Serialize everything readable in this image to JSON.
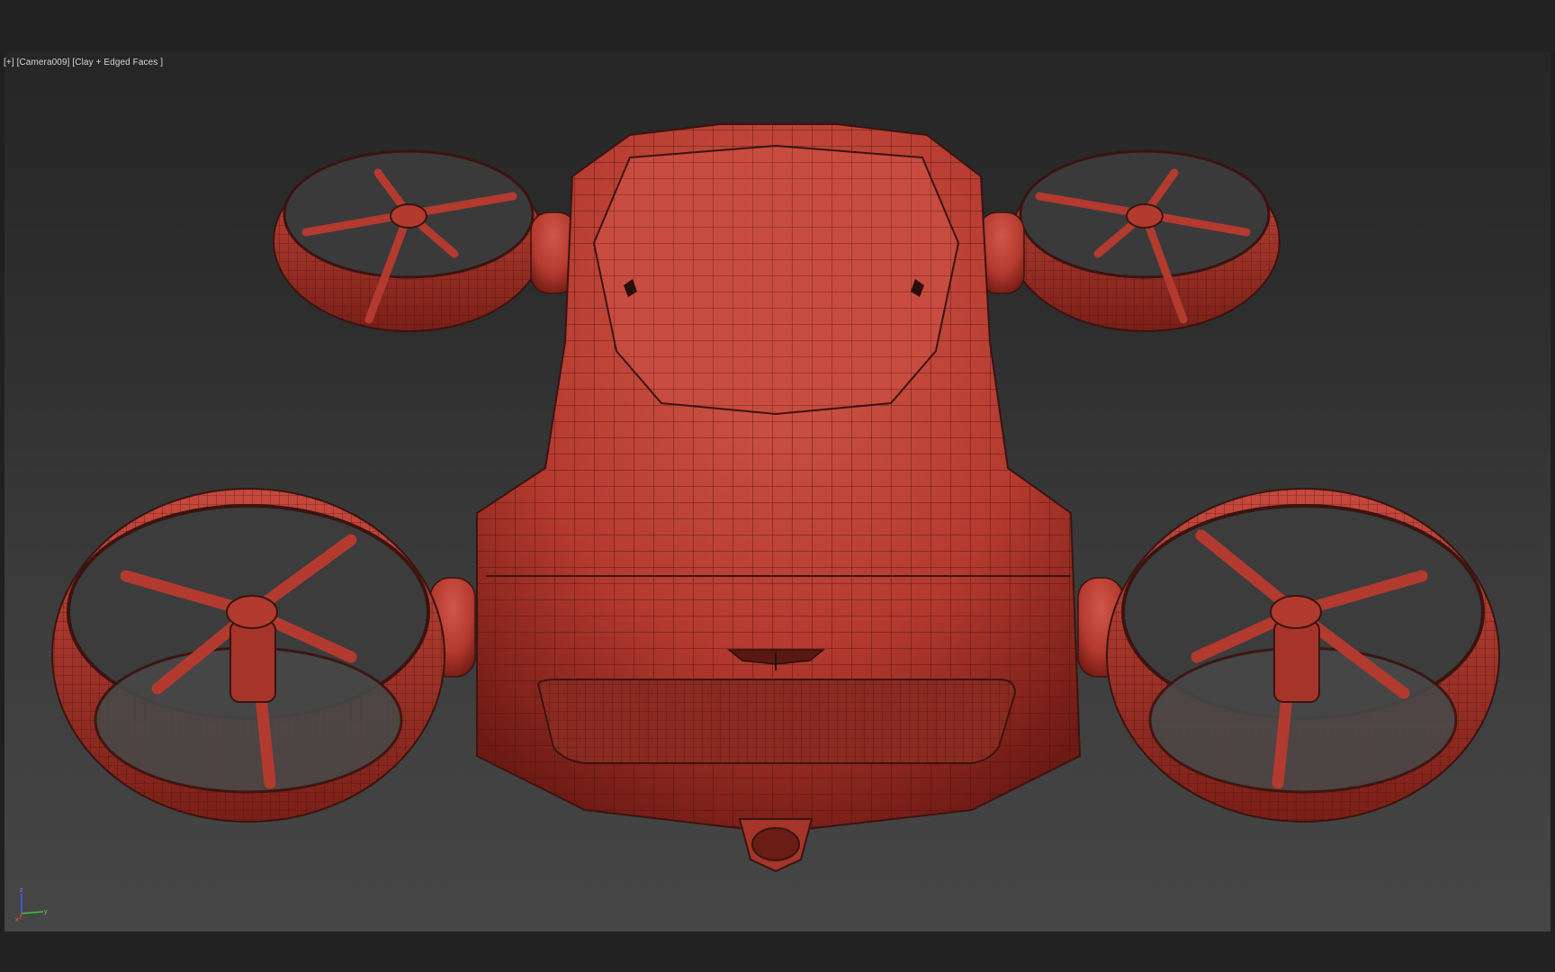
{
  "viewport": {
    "plus_menu": "[+]",
    "camera_menu": "[Camera009]",
    "shading_menu": "[Clay + Edged Faces ]"
  },
  "scene": {
    "object": "quad-rotor flying car model",
    "clay_color": "#c2463a",
    "wire_color": "#3a1410"
  },
  "axis_gizmo": {
    "z": "z",
    "x": "x",
    "y": "y",
    "z_color": "#3a5cff",
    "x_color": "#e03a3a",
    "y_color": "#3ac43a"
  }
}
